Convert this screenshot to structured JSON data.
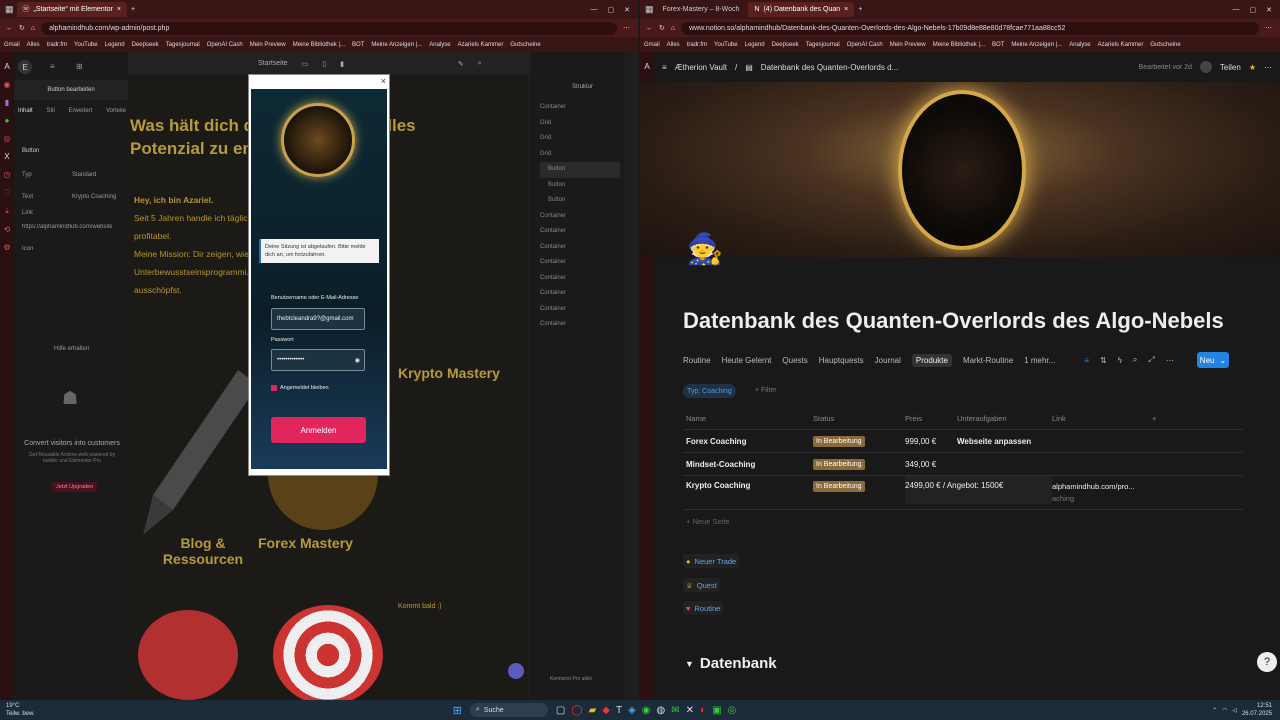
{
  "left": {
    "tabs": [
      {
        "label": "„Startseite“ mit Elementor"
      },
      {
        "label": "+"
      }
    ],
    "url": "alphamindhub.com/wp-admin/post.php",
    "bookmarks": [
      "Gmail",
      "Alles",
      "tradr.fm",
      "YouTube",
      "Legend",
      "Deepseek",
      "Tagesjournal",
      "OpenAI Cash",
      "Mein Preview",
      "Meine Bibliothek |...",
      "BOT",
      "Meine Anzeigen |...",
      "Analyse",
      "Azariels Kammer",
      "Gutscheine"
    ],
    "editor_panel": {
      "title": "Button bearbeiten",
      "tabs": [
        "Inhalt",
        "Stil",
        "Erweitert",
        "Vorteile"
      ],
      "section": "Button",
      "labels": [
        "Typ",
        "Text",
        "Link",
        "Icon"
      ],
      "values": [
        "Standard",
        "Krypto Coaching",
        "https://alphamindhub.com/websiteler"
      ],
      "promo_title": "Convert visitors into customers",
      "promo_text": "Get Reusable Actions-web powered by builder und Elementor Pro",
      "upgrade": "Jetzt Upgraden",
      "hilfe": "Hilfe erhalten"
    },
    "editor_top": {
      "device": "Startseite"
    },
    "canvas": {
      "heading": "Was hält dich davon ab, dein volles Potenzial zu entfesseln?",
      "lines": [
        "Hey, ich bin Azariel.",
        "Seit 5 Jahren handle ich täglich ... ada inzwischen nachhaltig",
        "profitabel.",
        "Meine Mission: Dir zeigen, wie ... ikomanagement und gezielter",
        "Unterbewusstseinsprogrammi... dein volles Potenzial",
        "ausschöpfst."
      ],
      "krypto": "Krypto Mastery",
      "blog": "Blog & Ressourcen",
      "forex": "Forex Mastery",
      "kommt": "Kommt bald :)"
    },
    "structure": {
      "title": "Struktur",
      "items": [
        "Container",
        "Grid",
        "Grid",
        "Grid",
        "Button",
        "Button",
        "Button",
        "Container",
        "Container",
        "Container",
        "Container",
        "Container",
        "Container",
        "Container",
        "Container"
      ]
    },
    "modal": {
      "close": "×",
      "notice": "Deine Sitzung ist abgelaufen. Bitte melde dich an, um fortzufahren.",
      "username_label": "Benutzername oder E-Mail-Adresse",
      "username_value": "thebtcleandra9?@gmail.com",
      "password_label": "Passwort",
      "password_value": "•••••••••••••",
      "remember": "Angemeldet bleiben",
      "login": "Anmelden"
    },
    "footer_note": "Kommt bald :)",
    "bottom_left": "Kennwort Pro aktiv"
  },
  "right": {
    "tabs": [
      {
        "label": "Forex-Mastery – 8-Woch"
      },
      {
        "label": "(4) Datenbank des Quan"
      },
      {
        "label": "+"
      }
    ],
    "url": "www.notion.so/alphamindhub/Datenbank-des-Quanten-Overlords-des-Algo-Nebels-17b09d8e88e80d78fcae771aa88cc52",
    "bookmarks": [
      "Gmail",
      "Alles",
      "tradr.fm",
      "YouTube",
      "Legend",
      "Deepseek",
      "Tagesjournal",
      "OpenAI Cash",
      "Mein Preview",
      "Meine Bibliothek |...",
      "BOT",
      "Meine Anzeigen |...",
      "Analyse",
      "Azariels Kammer",
      "Gutscheine"
    ],
    "workspace": "Ætherion Vault",
    "breadcrumb": "Datenbank des Quanten-Overlords d...",
    "edited": "Bearbeitet vor 2d",
    "share": "Teilen",
    "title": "Datenbank des Quanten-Overlords des Algo-Nebels",
    "views": [
      "Routine",
      "Heute Gelernt",
      "Quests",
      "Hauptquests",
      "Journal",
      "Produkte",
      "Markt-Routine",
      "1 mehr..."
    ],
    "active_view": "Produkte",
    "new_button": "Neu",
    "filter_chip": "Typ: Coaching",
    "filter_add": "+ Filter",
    "columns": [
      "Name",
      "Status",
      "Preis",
      "Unteraufgaben",
      "Link"
    ],
    "rows": [
      {
        "name": "Forex Coaching",
        "status": "In Bearbeitung",
        "preis": "999,00 €",
        "unter": "Webseite anpassen",
        "link": ""
      },
      {
        "name": "Mindset-Coaching",
        "status": "In Bearbeitung",
        "preis": "349,00 €",
        "unter": "",
        "link": ""
      },
      {
        "name": "Krypto Coaching",
        "status": "In Bearbeitung",
        "preis": "2499,00 € / Angebot: 1500€",
        "unter": "",
        "link": "alphamindhub.com/pro...",
        "link2": "aching"
      }
    ],
    "new_row": "+ Neue Seite",
    "buttons": [
      "Neuer Trade",
      "Quest",
      "Routine"
    ],
    "section": "Datenbank"
  },
  "taskbar": {
    "weather": "19°C",
    "weather_sub": "Teilw. bew.",
    "search": "Suche",
    "time": "12:51",
    "date": "26.07.2025"
  }
}
